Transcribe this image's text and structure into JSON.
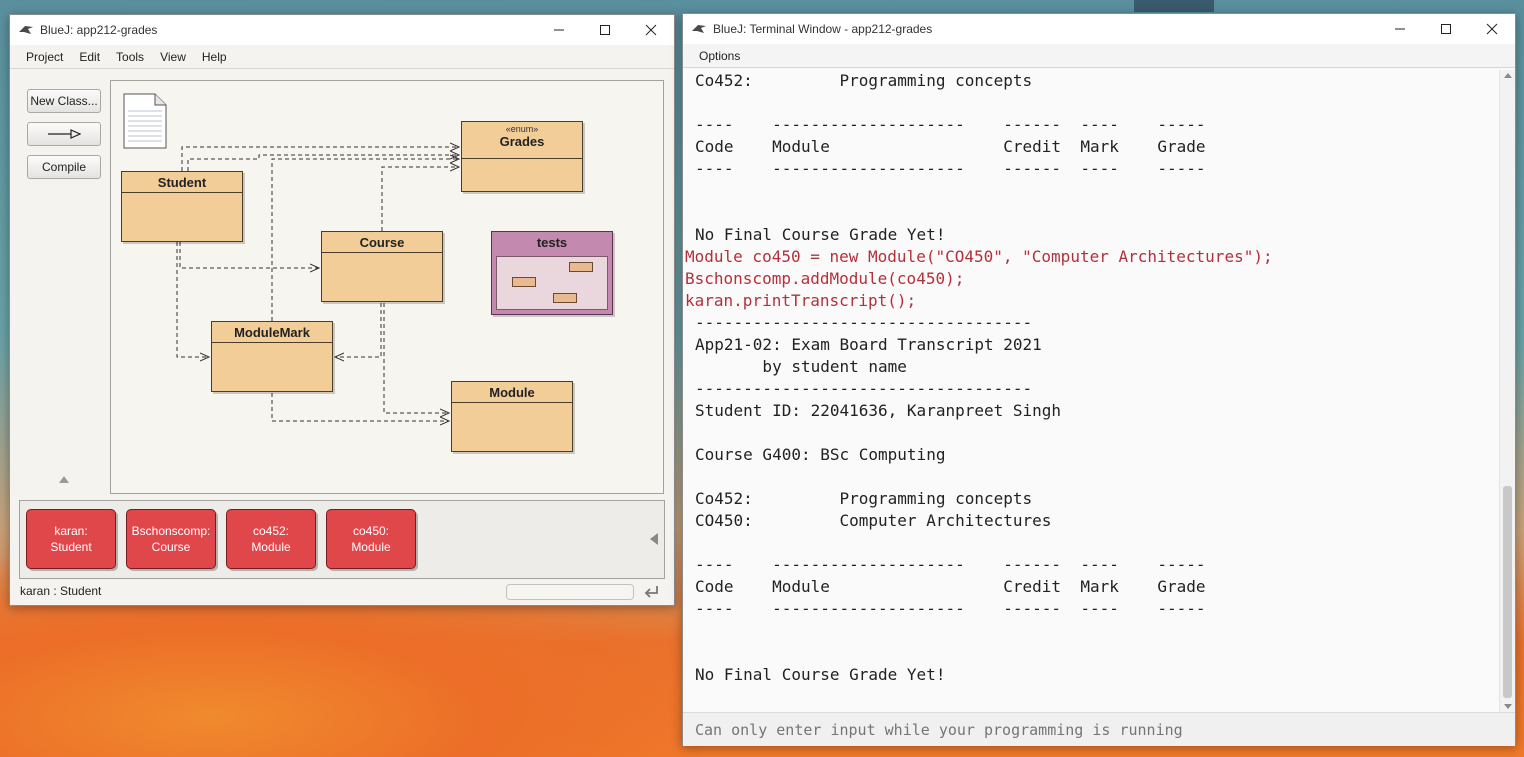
{
  "main_window": {
    "title": "BlueJ:  app212-grades",
    "menu": [
      "Project",
      "Edit",
      "Tools",
      "View",
      "Help"
    ],
    "tools": {
      "new_class": "New Class...",
      "compile": "Compile"
    },
    "classes": {
      "grades": {
        "stereotype": "«enum»",
        "name": "Grades"
      },
      "student": {
        "name": "Student"
      },
      "course": {
        "name": "Course"
      },
      "module_mark": {
        "name": "ModuleMark"
      },
      "module": {
        "name": "Module"
      },
      "tests_package": {
        "name": "tests"
      }
    },
    "objects": [
      {
        "name": "karan:",
        "type": "Student"
      },
      {
        "name": "Bschonscomp:",
        "type": "Course"
      },
      {
        "name": "co452:",
        "type": "Module"
      },
      {
        "name": "co450:",
        "type": "Module"
      }
    ],
    "status": "karan : Student"
  },
  "terminal": {
    "title": "BlueJ: Terminal Window - app212-grades",
    "menu": [
      "Options"
    ],
    "lines": [
      {
        "text": "Co452:         Programming concepts",
        "kind": "out"
      },
      {
        "text": "",
        "kind": "out"
      },
      {
        "text": "----    --------------------    ------  ----    -----",
        "kind": "out"
      },
      {
        "text": "Code    Module                  Credit  Mark    Grade",
        "kind": "out"
      },
      {
        "text": "----    --------------------    ------  ----    -----",
        "kind": "out"
      },
      {
        "text": "",
        "kind": "out"
      },
      {
        "text": "",
        "kind": "out"
      },
      {
        "text": "No Final Course Grade Yet!",
        "kind": "out"
      },
      {
        "text": "Module co450 = new Module(\"CO450\", \"Computer Architectures\");",
        "kind": "cmd"
      },
      {
        "text": "Bschonscomp.addModule(co450);",
        "kind": "cmd"
      },
      {
        "text": "karan.printTranscript();",
        "kind": "cmd"
      },
      {
        "text": "-----------------------------------",
        "kind": "out"
      },
      {
        "text": "App21-02: Exam Board Transcript 2021",
        "kind": "out"
      },
      {
        "text": "       by student name",
        "kind": "out"
      },
      {
        "text": "-----------------------------------",
        "kind": "out"
      },
      {
        "text": "Student ID: 22041636, Karanpreet Singh",
        "kind": "out"
      },
      {
        "text": "",
        "kind": "out"
      },
      {
        "text": "Course G400: BSc Computing",
        "kind": "out"
      },
      {
        "text": "",
        "kind": "out"
      },
      {
        "text": "Co452:         Programming concepts",
        "kind": "out"
      },
      {
        "text": "CO450:         Computer Architectures",
        "kind": "out"
      },
      {
        "text": "",
        "kind": "out"
      },
      {
        "text": "----    --------------------    ------  ----    -----",
        "kind": "out"
      },
      {
        "text": "Code    Module                  Credit  Mark    Grade",
        "kind": "out"
      },
      {
        "text": "----    --------------------    ------  ----    -----",
        "kind": "out"
      },
      {
        "text": "",
        "kind": "out"
      },
      {
        "text": "",
        "kind": "out"
      },
      {
        "text": "No Final Course Grade Yet!",
        "kind": "out"
      }
    ],
    "input_placeholder": "Can only enter input while your programming is running"
  },
  "colors": {
    "class_fill": "#f2cd98",
    "package_fill": "#c489ae",
    "object_fill": "#e0474b",
    "command_text": "#b4303a"
  },
  "icons": {
    "app": "bluej-bird-icon",
    "minimize": "minimize-icon",
    "maximize": "maximize-icon",
    "close": "close-icon",
    "readme": "readme-document-icon",
    "arrow": "uses-arrow-icon",
    "reset": "reset-vm-icon"
  }
}
